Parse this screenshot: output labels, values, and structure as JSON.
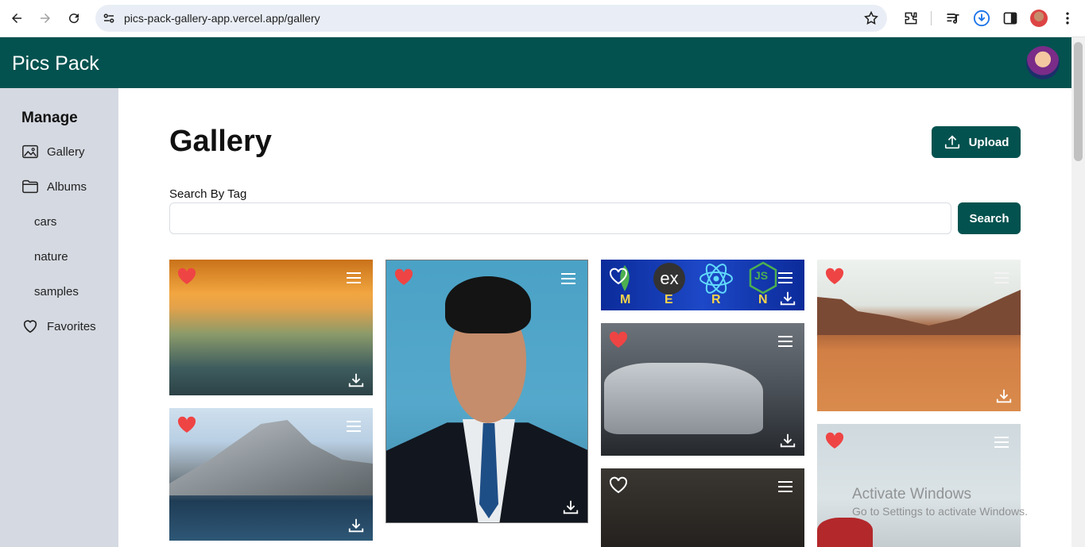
{
  "browser": {
    "url": "pics-pack-gallery-app.vercel.app/gallery"
  },
  "app": {
    "brand": "Pics Pack"
  },
  "sidebar": {
    "title": "Manage",
    "items": [
      {
        "label": "Gallery",
        "icon": "image-icon"
      },
      {
        "label": "Albums",
        "icon": "folder-icon"
      },
      {
        "label": "cars"
      },
      {
        "label": "nature"
      },
      {
        "label": "samples"
      },
      {
        "label": "Favorites",
        "icon": "heart-outline-icon"
      }
    ]
  },
  "main": {
    "title": "Gallery",
    "upload_label": "Upload",
    "search_label": "Search By Tag",
    "search_value": "",
    "search_button": "Search"
  },
  "gallery": {
    "images": [
      {
        "subject": "sunset-sea",
        "favorite": true
      },
      {
        "subject": "mountain-lake",
        "favorite": true
      },
      {
        "subject": "portrait",
        "favorite": true
      },
      {
        "subject": "mern-logos",
        "favorite": false,
        "logo_letters": [
          "M",
          "E",
          "R",
          "N"
        ],
        "ex_text": "ex",
        "js_text": "JS"
      },
      {
        "subject": "grey-car",
        "favorite": true
      },
      {
        "subject": "dark-room",
        "favorite": false
      },
      {
        "subject": "desert",
        "favorite": true
      },
      {
        "subject": "red-car",
        "favorite": true
      }
    ]
  },
  "watermark": {
    "line1": "Activate Windows",
    "line2": "Go to Settings to activate Windows."
  },
  "colors": {
    "brand": "#03524f",
    "sidebar": "#d5d9e1",
    "favorite": "#ef4444"
  }
}
